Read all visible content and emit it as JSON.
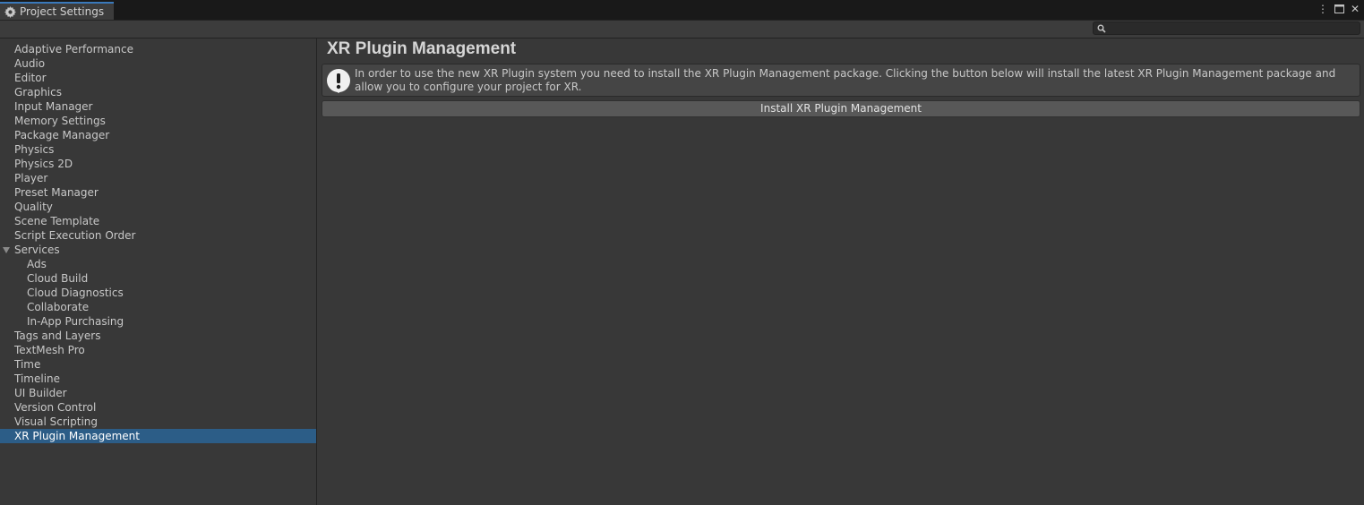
{
  "window": {
    "tab_title": "Project Settings",
    "controls": [
      "more-icon",
      "maximize-icon",
      "close-icon"
    ]
  },
  "search": {
    "placeholder": "",
    "value": ""
  },
  "sidebar": {
    "items": [
      {
        "label": "Adaptive Performance"
      },
      {
        "label": "Audio"
      },
      {
        "label": "Editor"
      },
      {
        "label": "Graphics"
      },
      {
        "label": "Input Manager"
      },
      {
        "label": "Memory Settings"
      },
      {
        "label": "Package Manager"
      },
      {
        "label": "Physics"
      },
      {
        "label": "Physics 2D"
      },
      {
        "label": "Player"
      },
      {
        "label": "Preset Manager"
      },
      {
        "label": "Quality"
      },
      {
        "label": "Scene Template"
      },
      {
        "label": "Script Execution Order"
      },
      {
        "label": "Services",
        "expanded": true
      },
      {
        "label": "Ads",
        "child": true
      },
      {
        "label": "Cloud Build",
        "child": true
      },
      {
        "label": "Cloud Diagnostics",
        "child": true
      },
      {
        "label": "Collaborate",
        "child": true
      },
      {
        "label": "In-App Purchasing",
        "child": true
      },
      {
        "label": "Tags and Layers"
      },
      {
        "label": "TextMesh Pro"
      },
      {
        "label": "Time"
      },
      {
        "label": "Timeline"
      },
      {
        "label": "UI Builder"
      },
      {
        "label": "Version Control"
      },
      {
        "label": "Visual Scripting"
      },
      {
        "label": "XR Plugin Management",
        "selected": true
      }
    ]
  },
  "main": {
    "title": "XR Plugin Management",
    "help_message": "In order to use the new XR Plugin system you need to install the XR Plugin Management package. Clicking the button below will install the latest XR Plugin Management package and allow you to configure your project for XR.",
    "install_button": "Install XR Plugin Management"
  },
  "colors": {
    "background": "#383838",
    "selection": "#2c5d87",
    "tab_accent": "#3a79bb"
  }
}
